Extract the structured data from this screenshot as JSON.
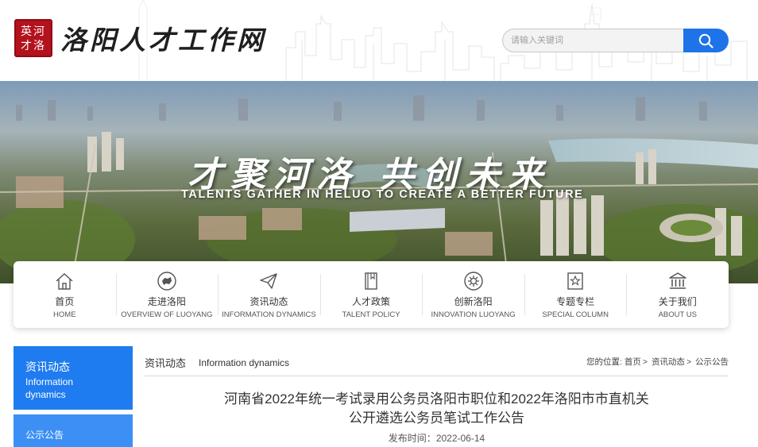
{
  "header": {
    "seal_text": "英河才洛",
    "site_title": "洛阳人才工作网",
    "search": {
      "placeholder": "请输入关键词"
    }
  },
  "banner": {
    "slogan_cn": "才聚河洛  共创未来",
    "slogan_en": "TALENTS GATHER IN HELUO TO CREATE A BETTER FUTURE"
  },
  "nav": {
    "items": [
      {
        "cn": "首页",
        "en": "HOME",
        "icon": "home-icon"
      },
      {
        "cn": "走进洛阳",
        "en": "OVERVIEW OF LUOYANG",
        "icon": "map-icon"
      },
      {
        "cn": "资讯动态",
        "en": "INFORMATION DYNAMICS",
        "icon": "paper-plane-icon"
      },
      {
        "cn": "人才政策",
        "en": "TALENT POLICY",
        "icon": "book-icon"
      },
      {
        "cn": "创新洛阳",
        "en": "INNOVATION LUOYANG",
        "icon": "gear-icon"
      },
      {
        "cn": "专题专栏",
        "en": "SPECIAL COLUMN",
        "icon": "star-bookmark-icon"
      },
      {
        "cn": "关于我们",
        "en": "ABOUT US",
        "icon": "building-icon"
      }
    ]
  },
  "sidebar": {
    "heading_cn": "资讯动态",
    "heading_en": "Information dynamics",
    "sub_item": "公示公告"
  },
  "main": {
    "section_cn": "资讯动态",
    "section_en": "Information dynamics",
    "breadcrumb": {
      "prefix": "您的位置:",
      "items": [
        "首页",
        "资讯动态",
        "公示公告"
      ],
      "separator": ">"
    },
    "article": {
      "title_line1": "河南省2022年统一考试录用公务员洛阳市职位和2022年洛阳市市直机关",
      "title_line2": "公开遴选公务员笔试工作公告",
      "date_label": "发布时间：",
      "date": "2022-06-14"
    }
  },
  "colors": {
    "accent": "#1f7cf0",
    "search_button": "#1f73e8",
    "seal": "#b3121d"
  }
}
